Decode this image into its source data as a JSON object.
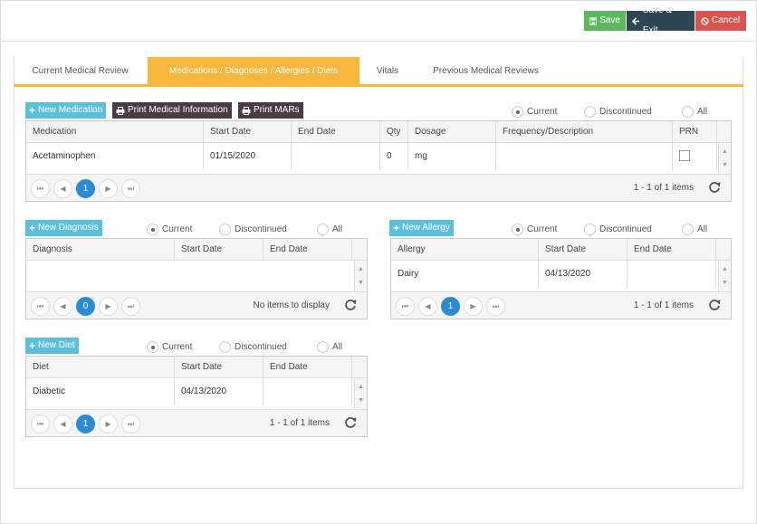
{
  "toolbar": {
    "save_label": "Save",
    "save_exit_label": "Save & Exit",
    "cancel_label": "Cancel"
  },
  "tabs": [
    {
      "label": "Current Medical Review"
    },
    {
      "label": "Medications / Diagnoses / Allergies / Diets"
    },
    {
      "label": "Vitals"
    },
    {
      "label": "Previous Medical Reviews"
    }
  ],
  "active_tab": 1,
  "filters": {
    "current": "Current",
    "discontinued": "Discontinued",
    "all": "All"
  },
  "medications": {
    "new_label": "New Medication",
    "print_info_label": "Print Medical Information",
    "print_mars_label": "Print MARs",
    "columns": [
      "Medication",
      "Start Date",
      "End Date",
      "Qty",
      "Dosage",
      "Frequency/Description",
      "PRN"
    ],
    "rows": [
      {
        "medication": "Acetaminophen",
        "start": "01/15/2020",
        "end": "",
        "qty": "0",
        "dosage": "mg",
        "freq": "",
        "prn": false
      }
    ],
    "page": "1",
    "info": "1 - 1 of 1 items"
  },
  "diagnosis": {
    "new_label": "New Diagnosis",
    "columns": [
      "Diagnosis",
      "Start Date",
      "End Date"
    ],
    "rows": [],
    "page": "0",
    "info": "No items to display"
  },
  "allergy": {
    "new_label": "New Allergy",
    "columns": [
      "Allergy",
      "Start Date",
      "End Date"
    ],
    "rows": [
      {
        "name": "Dairy",
        "start": "04/13/2020",
        "end": ""
      }
    ],
    "page": "1",
    "info": "1 - 1 of 1 items"
  },
  "diet": {
    "new_label": "New Diet",
    "columns": [
      "Diet",
      "Start Date",
      "End Date"
    ],
    "rows": [
      {
        "name": "Diabetic",
        "start": "04/13/2020",
        "end": ""
      }
    ],
    "page": "1",
    "info": "1 - 1 of 1 items"
  },
  "icons": {
    "save": "floppy-icon",
    "save_exit": "arrow-left-icon",
    "cancel": "ban-icon",
    "new": "plus-icon",
    "print": "printer-icon",
    "refresh": "refresh-icon"
  },
  "colors": {
    "save": "#5cb85c",
    "save_exit": "#2e4554",
    "cancel": "#d9534f",
    "accent": "#f6b73c",
    "new_button": "#5bc0de",
    "print_button": "#4a3b46",
    "page_current": "#2b8bd4"
  }
}
